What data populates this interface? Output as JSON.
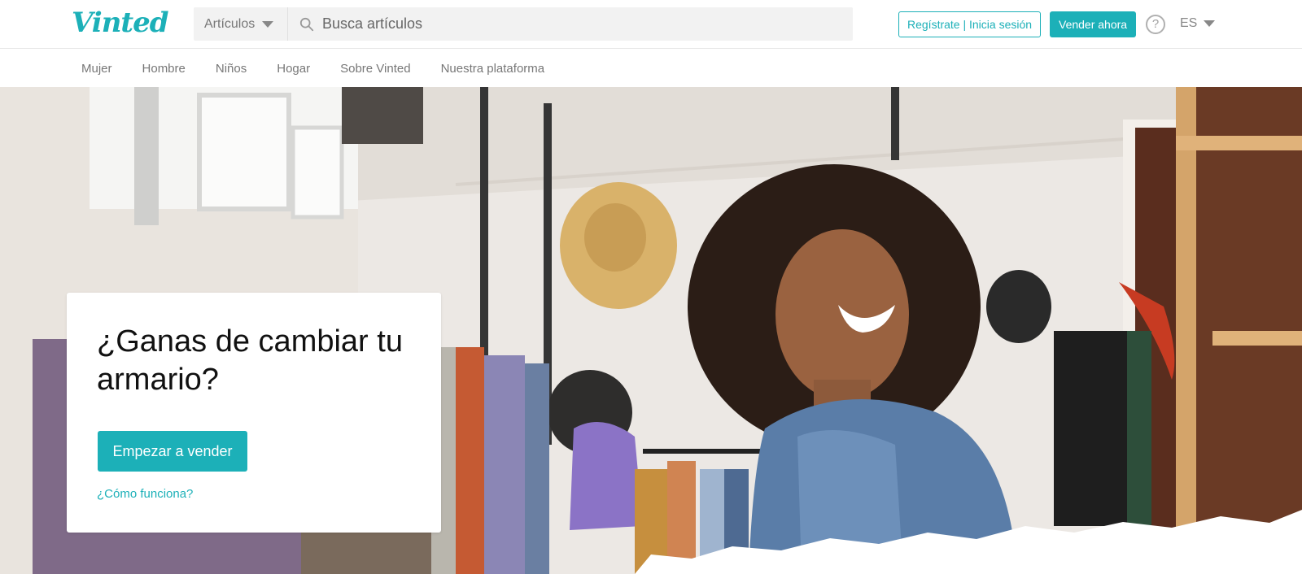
{
  "brand": {
    "logo_text": "Vinted",
    "accent": "#1cb0b8"
  },
  "search": {
    "category_label": "Artículos",
    "placeholder": "Busca artículos",
    "search_icon": "search-icon"
  },
  "header": {
    "login_label": "Regístrate | Inicia sesión",
    "sell_label": "Vender ahora",
    "help_icon": "help-icon",
    "help_glyph": "?",
    "language": "ES"
  },
  "nav": {
    "items": [
      {
        "label": "Mujer"
      },
      {
        "label": "Hombre"
      },
      {
        "label": "Niños"
      },
      {
        "label": "Hogar"
      },
      {
        "label": "Sobre Vinted"
      },
      {
        "label": "Nuestra plataforma"
      }
    ]
  },
  "hero": {
    "title": "¿Ganas de cambiar tu armario?",
    "cta_label": "Empezar a vender",
    "how_link": "¿Cómo funciona?"
  }
}
